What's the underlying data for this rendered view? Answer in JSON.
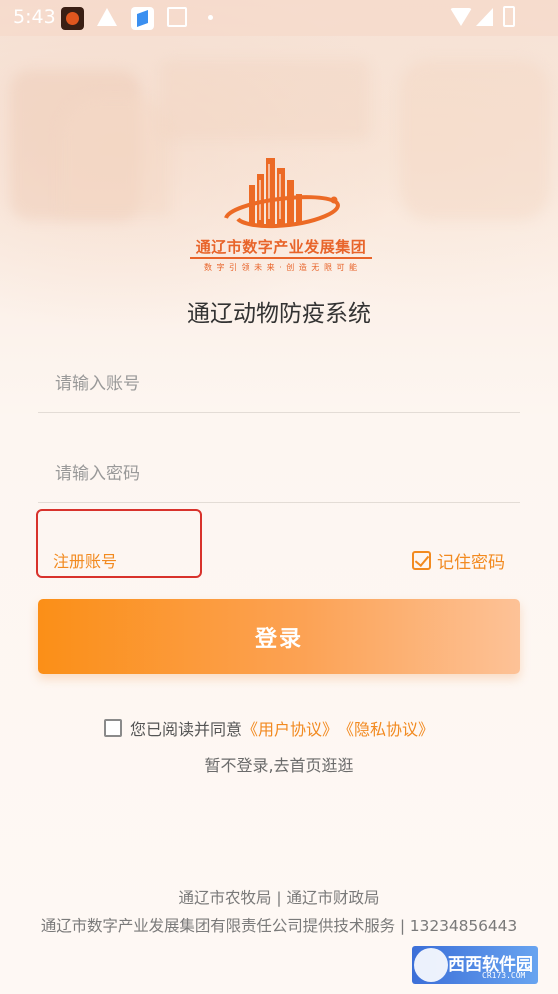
{
  "status_bar": {
    "time": "5:43",
    "icons": [
      "app-icon",
      "warning-icon",
      "app-icon",
      "image-icon",
      "dot-icon",
      "wifi-icon",
      "signal-icon",
      "battery-icon"
    ]
  },
  "logo": {
    "company_name": "通辽市数字产业发展集团",
    "slogan": "数 字 引 领 未 来 · 创 造 无 限 可 能"
  },
  "app_title": "通辽动物防疫系统",
  "form": {
    "account_placeholder": "请输入账号",
    "password_placeholder": "请输入密码",
    "register_label": "注册账号",
    "remember_label": "记住密码",
    "remember_checked": true,
    "login_label": "登录"
  },
  "agreement": {
    "prefix": "您已阅读并同意",
    "user_agreement": "《用户协议》",
    "privacy_agreement": "《隐私协议》",
    "checked": false
  },
  "guest_label": "暂不登录,去首页逛逛",
  "footer": {
    "line1": "通辽市农牧局 | 通辽市财政局",
    "line2": "通辽市数字产业发展集团有限责任公司提供技术服务 | 13234856443"
  },
  "watermark": {
    "title": "西西软件园",
    "domain": "CR173.COM"
  },
  "colors": {
    "accent": "#f28a20",
    "highlight_box": "#d8322c",
    "login_gradient_start": "#fb8f17",
    "login_gradient_end": "#fdc297"
  }
}
